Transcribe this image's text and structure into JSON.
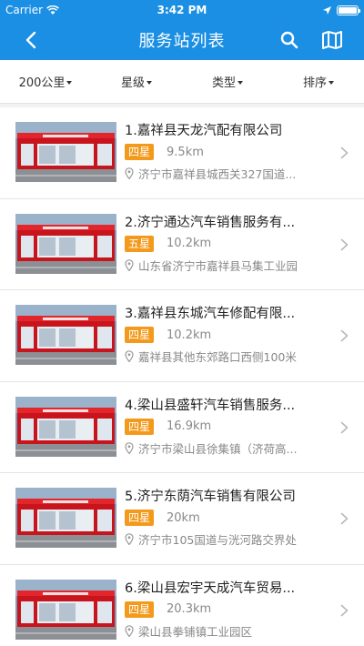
{
  "status_bar": {
    "carrier": "Carrier",
    "time": "3:42 PM"
  },
  "nav": {
    "title": "服务站列表"
  },
  "filters": [
    {
      "label": "200公里"
    },
    {
      "label": "星级"
    },
    {
      "label": "类型"
    },
    {
      "label": "排序"
    }
  ],
  "stations": [
    {
      "name": "1.嘉祥县天龙汽配有限公司",
      "rating": "四星",
      "distance": "9.5km",
      "address": "济宁市嘉祥县城西关327国道..."
    },
    {
      "name": "2.济宁通达汽车销售服务有...",
      "rating": "五星",
      "distance": "10.2km",
      "address": "山东省济宁市嘉祥县马集工业园"
    },
    {
      "name": "3.嘉祥县东城汽车修配有限...",
      "rating": "四星",
      "distance": "10.2km",
      "address": "嘉祥县其他东郊路口西侧100米"
    },
    {
      "name": "4.梁山县盛轩汽车销售服务...",
      "rating": "四星",
      "distance": "16.9km",
      "address": "济宁市梁山县徐集镇（济荷高..."
    },
    {
      "name": "5.济宁东荫汽车销售有限公司",
      "rating": "四星",
      "distance": "20km",
      "address": "济宁市105国道与洸河路交界处"
    },
    {
      "name": "6.梁山县宏宇天成汽车贸易...",
      "rating": "四星",
      "distance": "20.3km",
      "address": "梁山县拳铺镇工业园区"
    }
  ],
  "colors": {
    "primary": "#1a8fe3",
    "badge": "#f39a1c"
  }
}
